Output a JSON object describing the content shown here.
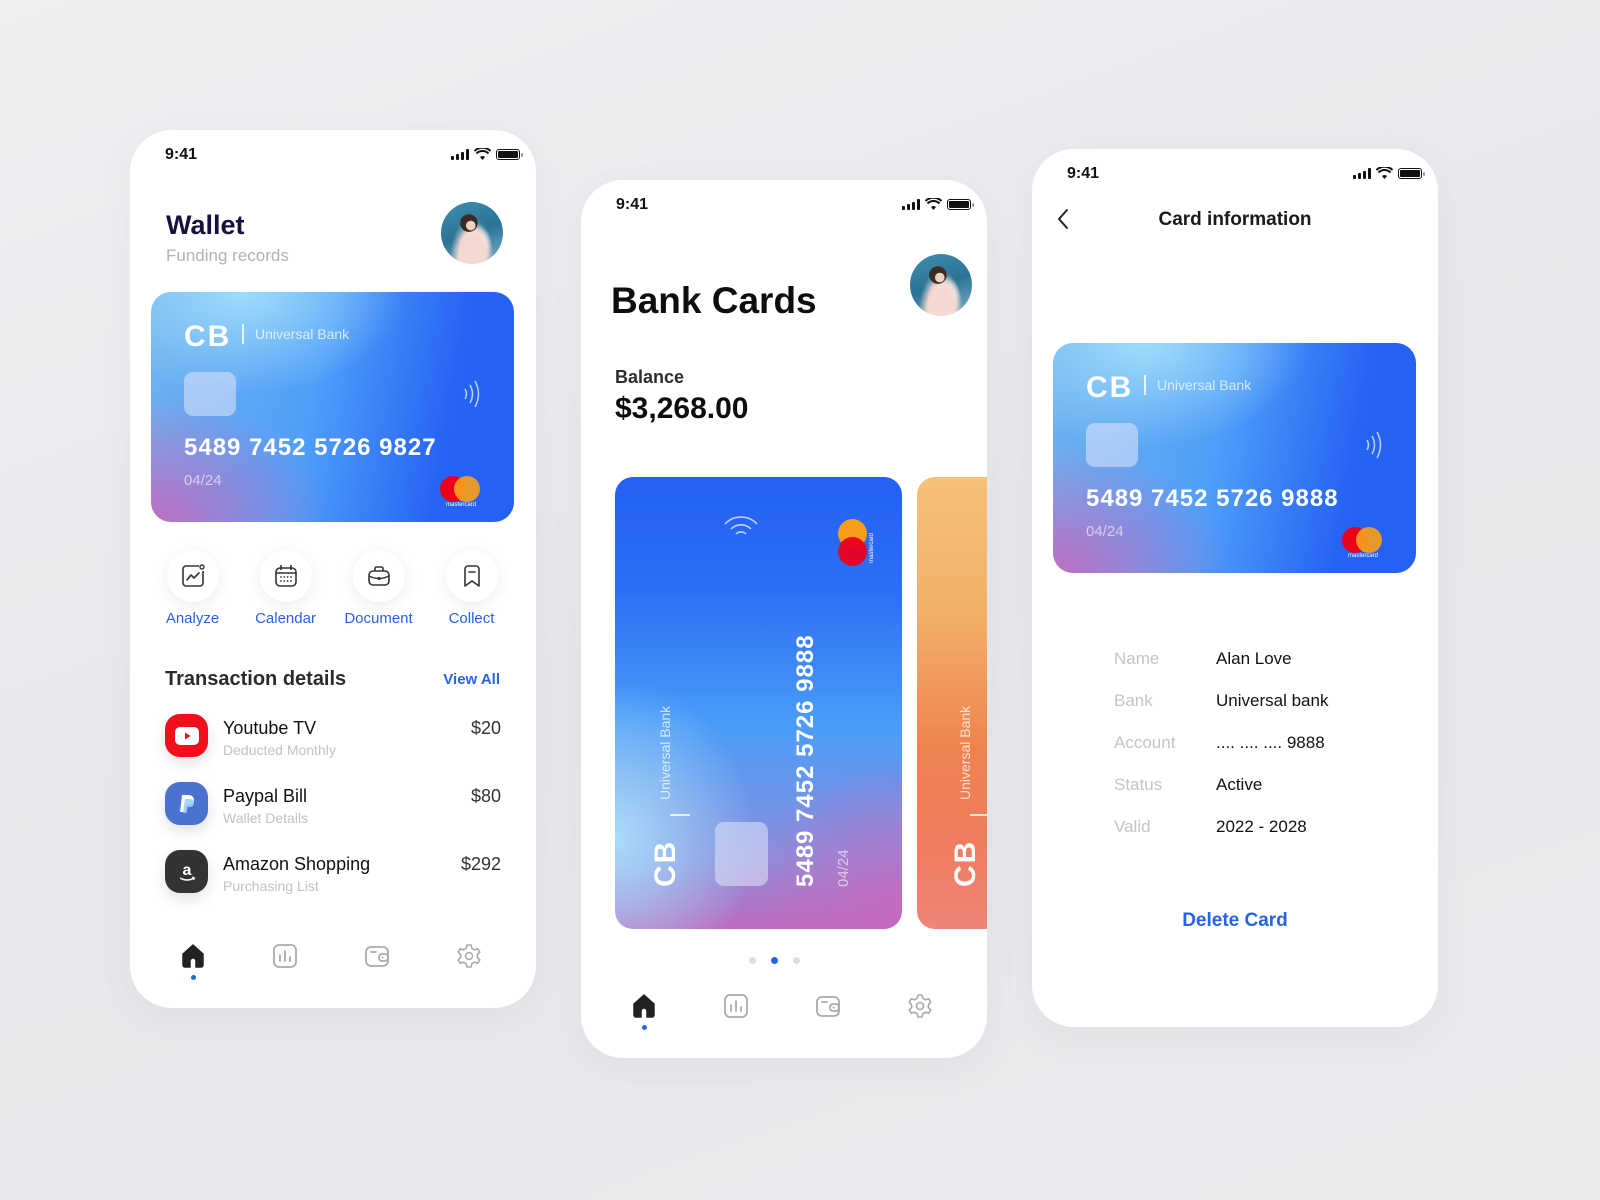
{
  "status_bar": {
    "time": "9:41"
  },
  "colors": {
    "accent": "#2563eb",
    "mastercard_red": "#eb001b",
    "mastercard_orange": "#f79e1b"
  },
  "wallet_screen": {
    "title": "Wallet",
    "subtitle": "Funding records",
    "card": {
      "logo": "CB",
      "bank": "Universal Bank",
      "number": "5489 7452 5726 9827",
      "expiry": "04/24",
      "network": "mastercard"
    },
    "actions": [
      {
        "label": "Analyze",
        "icon": "analyze-chart-icon"
      },
      {
        "label": "Calendar",
        "icon": "calendar-icon"
      },
      {
        "label": "Document",
        "icon": "briefcase-icon"
      },
      {
        "label": "Collect",
        "icon": "bookmark-icon"
      }
    ],
    "transactions": {
      "heading": "Transaction details",
      "view_all": "View All",
      "items": [
        {
          "name": "Youtube TV",
          "desc": "Deducted Monthly",
          "amount": "$20",
          "icon": "youtube-icon"
        },
        {
          "name": "Paypal Bill",
          "desc": "Wallet Details",
          "amount": "$80",
          "icon": "paypal-icon"
        },
        {
          "name": "Amazon Shopping",
          "desc": "Purchasing List",
          "amount": "$292",
          "icon": "amazon-icon"
        }
      ]
    },
    "tabs": [
      "home",
      "stats",
      "wallet",
      "settings"
    ],
    "active_tab": "home"
  },
  "bank_cards_screen": {
    "title": "Bank Cards",
    "balance_label": "Balance",
    "balance": "$3,268.00",
    "card": {
      "logo": "CB",
      "bank": "Universal Bank",
      "number": "5489 7452 5726 9888",
      "expiry": "04/24",
      "network": "mastercard"
    },
    "next_card": {
      "logo": "CB",
      "bank": "Universal Bank"
    },
    "pager": {
      "count": 3,
      "active_index": 1
    },
    "tabs": [
      "home",
      "stats",
      "wallet",
      "settings"
    ],
    "active_tab": "home"
  },
  "card_info_screen": {
    "title": "Card information",
    "card": {
      "logo": "CB",
      "bank": "Universal Bank",
      "number": "5489 7452 5726 9888",
      "expiry": "04/24",
      "network": "mastercard"
    },
    "details": [
      {
        "label": "Name",
        "value": "Alan Love"
      },
      {
        "label": "Bank",
        "value": "Universal bank"
      },
      {
        "label": "Account",
        "value": ".... .... .... 9888"
      },
      {
        "label": "Status",
        "value": "Active"
      },
      {
        "label": "Valid",
        "value": "2022 - 2028"
      }
    ],
    "delete_label": "Delete Card"
  }
}
